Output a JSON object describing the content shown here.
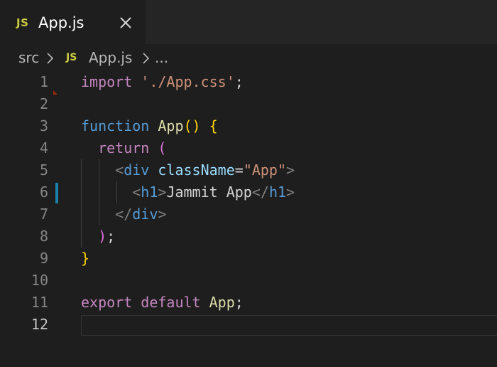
{
  "tab": {
    "icon_label": "JS",
    "title": "App.js",
    "close_icon": "close-icon"
  },
  "breadcrumb": {
    "segments": [
      "src",
      "App.js",
      "..."
    ],
    "file_icon_label": "JS"
  },
  "editor": {
    "line_numbers": [
      "1",
      "2",
      "3",
      "4",
      "5",
      "6",
      "7",
      "8",
      "9",
      "10",
      "11",
      "12"
    ],
    "lines": [
      [
        {
          "t": "kw",
          "v": "import"
        },
        {
          "t": "plain",
          "v": " "
        },
        {
          "t": "str",
          "v": "'./App.css'"
        },
        {
          "t": "plain",
          "v": ";"
        }
      ],
      [],
      [
        {
          "t": "fn-kw",
          "v": "function"
        },
        {
          "t": "plain",
          "v": " "
        },
        {
          "t": "fn",
          "v": "App"
        },
        {
          "t": "brace",
          "v": "()"
        },
        {
          "t": "plain",
          "v": " "
        },
        {
          "t": "brace",
          "v": "{"
        }
      ],
      [
        {
          "t": "plain",
          "v": "  "
        },
        {
          "t": "kw",
          "v": "return"
        },
        {
          "t": "plain",
          "v": " "
        },
        {
          "t": "paren2",
          "v": "("
        }
      ],
      [
        {
          "t": "plain",
          "v": "    "
        },
        {
          "t": "punct",
          "v": "<"
        },
        {
          "t": "tag",
          "v": "div"
        },
        {
          "t": "plain",
          "v": " "
        },
        {
          "t": "attr",
          "v": "className"
        },
        {
          "t": "plain",
          "v": "="
        },
        {
          "t": "str",
          "v": "\"App\""
        },
        {
          "t": "punct",
          "v": ">"
        }
      ],
      [
        {
          "t": "plain",
          "v": "      "
        },
        {
          "t": "punct",
          "v": "<"
        },
        {
          "t": "tag",
          "v": "h1"
        },
        {
          "t": "punct",
          "v": ">"
        },
        {
          "t": "plain",
          "v": "Jammit App"
        },
        {
          "t": "punct",
          "v": "</"
        },
        {
          "t": "tag",
          "v": "h1"
        },
        {
          "t": "punct",
          "v": ">"
        }
      ],
      [
        {
          "t": "plain",
          "v": "    "
        },
        {
          "t": "punct",
          "v": "</"
        },
        {
          "t": "tag",
          "v": "div"
        },
        {
          "t": "punct",
          "v": ">"
        }
      ],
      [
        {
          "t": "plain",
          "v": "  "
        },
        {
          "t": "paren2",
          "v": ")"
        },
        {
          "t": "plain",
          "v": ";"
        }
      ],
      [
        {
          "t": "brace",
          "v": "}"
        }
      ],
      [],
      [
        {
          "t": "kw",
          "v": "export"
        },
        {
          "t": "plain",
          "v": " "
        },
        {
          "t": "kw",
          "v": "default"
        },
        {
          "t": "plain",
          "v": " "
        },
        {
          "t": "fn",
          "v": "App"
        },
        {
          "t": "plain",
          "v": ";"
        }
      ],
      []
    ],
    "modified_line": 6,
    "current_line": 12
  },
  "colors": {
    "background": "#1e1e1e",
    "tabbar": "#252526",
    "keyword": "#c586c0",
    "function_keyword": "#569cd6",
    "string": "#ce9178",
    "function_name": "#dcdcaa",
    "bracket": "#ffd700",
    "tag": "#569cd6",
    "attribute": "#9cdcfe",
    "modified_gutter": "#1b81a8",
    "js_icon": "#cbcb41"
  }
}
